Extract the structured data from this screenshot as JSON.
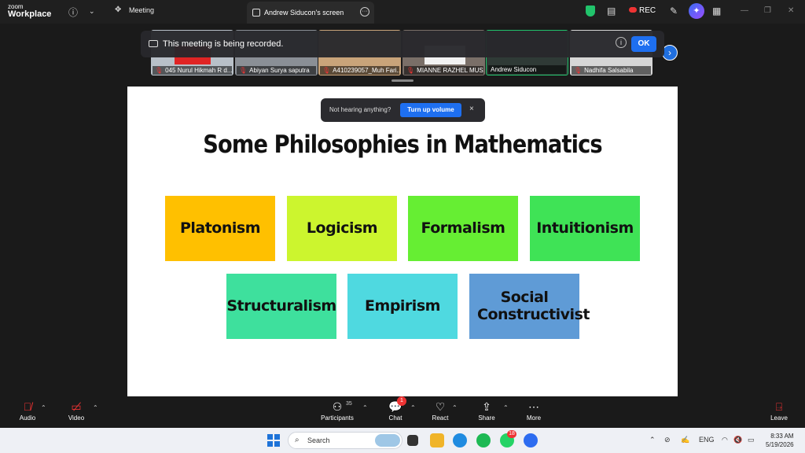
{
  "app": {
    "logo_line1": "zoom",
    "logo_line2": "Workplace"
  },
  "topbar": {
    "meeting_label": "Meeting",
    "screen_tab_label": "Andrew Siducon's screen",
    "rec_label": "REC"
  },
  "participants": [
    {
      "name": "045 Nurul Hikmah R d..."
    },
    {
      "name": "Abiyan Surya saputra"
    },
    {
      "name": "A410239057_Muh Fari..."
    },
    {
      "name": "MIANNE RAZHEL MUSA"
    },
    {
      "name": "Andrew Siducon"
    },
    {
      "name": "Nadhifa Salsabila"
    }
  ],
  "recording_banner": {
    "message": "This meeting is being recorded.",
    "ok_label": "OK"
  },
  "audio_toast": {
    "message": "Not hearing anything?",
    "button_label": "Turn up volume",
    "close": "×"
  },
  "slide": {
    "title": "Some Philosophies in Mathematics",
    "boxes": [
      {
        "label": "Platonism",
        "color": "#ffc000"
      },
      {
        "label": "Logicism",
        "color": "#ccf52e"
      },
      {
        "label": "Formalism",
        "color": "#66ee33"
      },
      {
        "label": "Intuitionism",
        "color": "#3fe356"
      },
      {
        "label": "Structuralism",
        "color": "#3ee09d"
      },
      {
        "label": "Empirism",
        "color": "#4fd9e0"
      },
      {
        "label": "Social Constructivist",
        "color": "#5f9bd6"
      }
    ]
  },
  "toolbar": {
    "audio_label": "Audio",
    "video_label": "Video",
    "participants_label": "Participants",
    "participants_count": "35",
    "chat_label": "Chat",
    "chat_badge": "1",
    "react_label": "React",
    "share_label": "Share",
    "more_label": "More",
    "leave_label": "Leave"
  },
  "taskbar": {
    "search_placeholder": "Search",
    "whatsapp_badge": "18",
    "lang": "ENG",
    "time": "8:33 AM",
    "date": "5/19/2026"
  }
}
